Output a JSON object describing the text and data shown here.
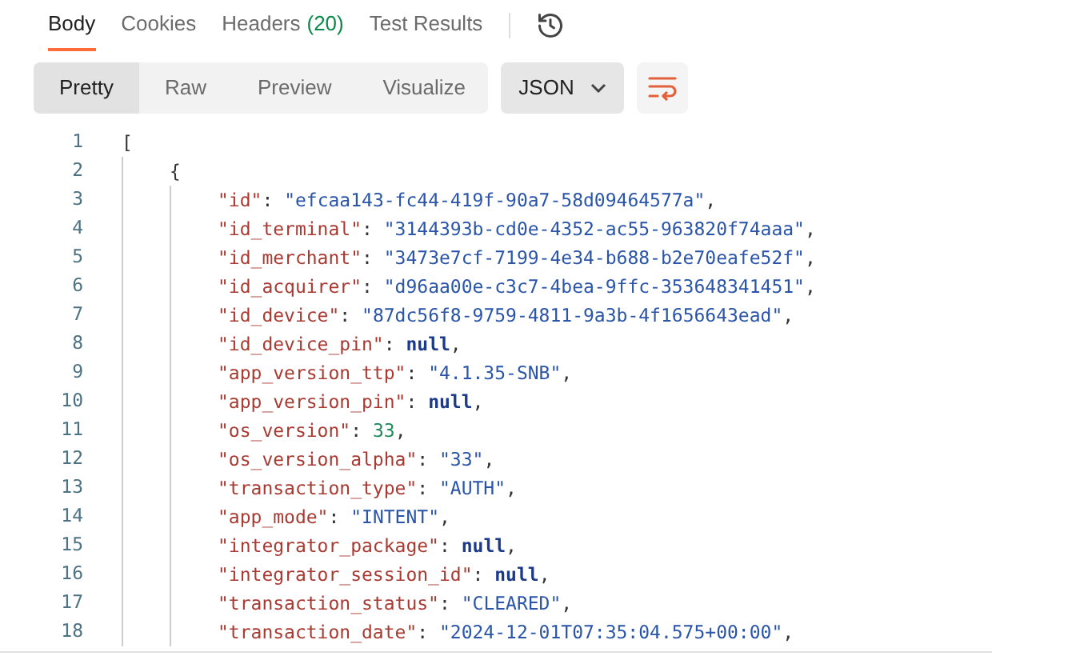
{
  "tabs": [
    {
      "label": "Body",
      "selected": true
    },
    {
      "label": "Cookies",
      "selected": false
    },
    {
      "label": "Headers",
      "count": "(20)",
      "selected": false
    },
    {
      "label": "Test Results",
      "selected": false
    }
  ],
  "view_modes": [
    {
      "label": "Pretty",
      "selected": true
    },
    {
      "label": "Raw",
      "selected": false
    },
    {
      "label": "Preview",
      "selected": false
    },
    {
      "label": "Visualize",
      "selected": false
    }
  ],
  "format_dropdown": {
    "value": "JSON"
  },
  "code": [
    {
      "number": "1",
      "tokens": [
        {
          "kind": "punct",
          "text": "["
        }
      ],
      "children": [
        {
          "number": "2",
          "tokens": [
            {
              "kind": "punct",
              "text": "{"
            }
          ],
          "children": [
            {
              "number": "3",
              "tokens": [
                {
                  "kind": "key",
                  "text": "\"id\""
                },
                {
                  "kind": "punct",
                  "text": ": "
                },
                {
                  "kind": "string",
                  "text": "\"efcaa143-fc44-419f-90a7-58d09464577a\""
                },
                {
                  "kind": "punct",
                  "text": ","
                }
              ]
            },
            {
              "number": "4",
              "tokens": [
                {
                  "kind": "key",
                  "text": "\"id_terminal\""
                },
                {
                  "kind": "punct",
                  "text": ": "
                },
                {
                  "kind": "string",
                  "text": "\"3144393b-cd0e-4352-ac55-963820f74aaa\""
                },
                {
                  "kind": "punct",
                  "text": ","
                }
              ]
            },
            {
              "number": "5",
              "tokens": [
                {
                  "kind": "key",
                  "text": "\"id_merchant\""
                },
                {
                  "kind": "punct",
                  "text": ": "
                },
                {
                  "kind": "string",
                  "text": "\"3473e7cf-7199-4e34-b688-b2e70eafe52f\""
                },
                {
                  "kind": "punct",
                  "text": ","
                }
              ]
            },
            {
              "number": "6",
              "tokens": [
                {
                  "kind": "key",
                  "text": "\"id_acquirer\""
                },
                {
                  "kind": "punct",
                  "text": ": "
                },
                {
                  "kind": "string",
                  "text": "\"d96aa00e-c3c7-4bea-9ffc-353648341451\""
                },
                {
                  "kind": "punct",
                  "text": ","
                }
              ]
            },
            {
              "number": "7",
              "tokens": [
                {
                  "kind": "key",
                  "text": "\"id_device\""
                },
                {
                  "kind": "punct",
                  "text": ": "
                },
                {
                  "kind": "string",
                  "text": "\"87dc56f8-9759-4811-9a3b-4f1656643ead\""
                },
                {
                  "kind": "punct",
                  "text": ","
                }
              ]
            },
            {
              "number": "8",
              "tokens": [
                {
                  "kind": "key",
                  "text": "\"id_device_pin\""
                },
                {
                  "kind": "punct",
                  "text": ": "
                },
                {
                  "kind": "null",
                  "text": "null"
                },
                {
                  "kind": "punct",
                  "text": ","
                }
              ]
            },
            {
              "number": "9",
              "tokens": [
                {
                  "kind": "key",
                  "text": "\"app_version_ttp\""
                },
                {
                  "kind": "punct",
                  "text": ": "
                },
                {
                  "kind": "string",
                  "text": "\"4.1.35-SNB\""
                },
                {
                  "kind": "punct",
                  "text": ","
                }
              ]
            },
            {
              "number": "10",
              "tokens": [
                {
                  "kind": "key",
                  "text": "\"app_version_pin\""
                },
                {
                  "kind": "punct",
                  "text": ": "
                },
                {
                  "kind": "null",
                  "text": "null"
                },
                {
                  "kind": "punct",
                  "text": ","
                }
              ]
            },
            {
              "number": "11",
              "tokens": [
                {
                  "kind": "key",
                  "text": "\"os_version\""
                },
                {
                  "kind": "punct",
                  "text": ": "
                },
                {
                  "kind": "number",
                  "text": "33"
                },
                {
                  "kind": "punct",
                  "text": ","
                }
              ]
            },
            {
              "number": "12",
              "tokens": [
                {
                  "kind": "key",
                  "text": "\"os_version_alpha\""
                },
                {
                  "kind": "punct",
                  "text": ": "
                },
                {
                  "kind": "string",
                  "text": "\"33\""
                },
                {
                  "kind": "punct",
                  "text": ","
                }
              ]
            },
            {
              "number": "13",
              "tokens": [
                {
                  "kind": "key",
                  "text": "\"transaction_type\""
                },
                {
                  "kind": "punct",
                  "text": ": "
                },
                {
                  "kind": "string",
                  "text": "\"AUTH\""
                },
                {
                  "kind": "punct",
                  "text": ","
                }
              ]
            },
            {
              "number": "14",
              "tokens": [
                {
                  "kind": "key",
                  "text": "\"app_mode\""
                },
                {
                  "kind": "punct",
                  "text": ": "
                },
                {
                  "kind": "string",
                  "text": "\"INTENT\""
                },
                {
                  "kind": "punct",
                  "text": ","
                }
              ]
            },
            {
              "number": "15",
              "tokens": [
                {
                  "kind": "key",
                  "text": "\"integrator_package\""
                },
                {
                  "kind": "punct",
                  "text": ": "
                },
                {
                  "kind": "null",
                  "text": "null"
                },
                {
                  "kind": "punct",
                  "text": ","
                }
              ]
            },
            {
              "number": "16",
              "tokens": [
                {
                  "kind": "key",
                  "text": "\"integrator_session_id\""
                },
                {
                  "kind": "punct",
                  "text": ": "
                },
                {
                  "kind": "null",
                  "text": "null"
                },
                {
                  "kind": "punct",
                  "text": ","
                }
              ]
            },
            {
              "number": "17",
              "tokens": [
                {
                  "kind": "key",
                  "text": "\"transaction_status\""
                },
                {
                  "kind": "punct",
                  "text": ": "
                },
                {
                  "kind": "string",
                  "text": "\"CLEARED\""
                },
                {
                  "kind": "punct",
                  "text": ","
                }
              ]
            },
            {
              "number": "18",
              "tokens": [
                {
                  "kind": "key",
                  "text": "\"transaction_date\""
                },
                {
                  "kind": "punct",
                  "text": ": "
                },
                {
                  "kind": "string",
                  "text": "\"2024-12-01T07:35:04.575+00:00\""
                },
                {
                  "kind": "punct",
                  "text": ","
                }
              ]
            }
          ]
        }
      ]
    }
  ]
}
